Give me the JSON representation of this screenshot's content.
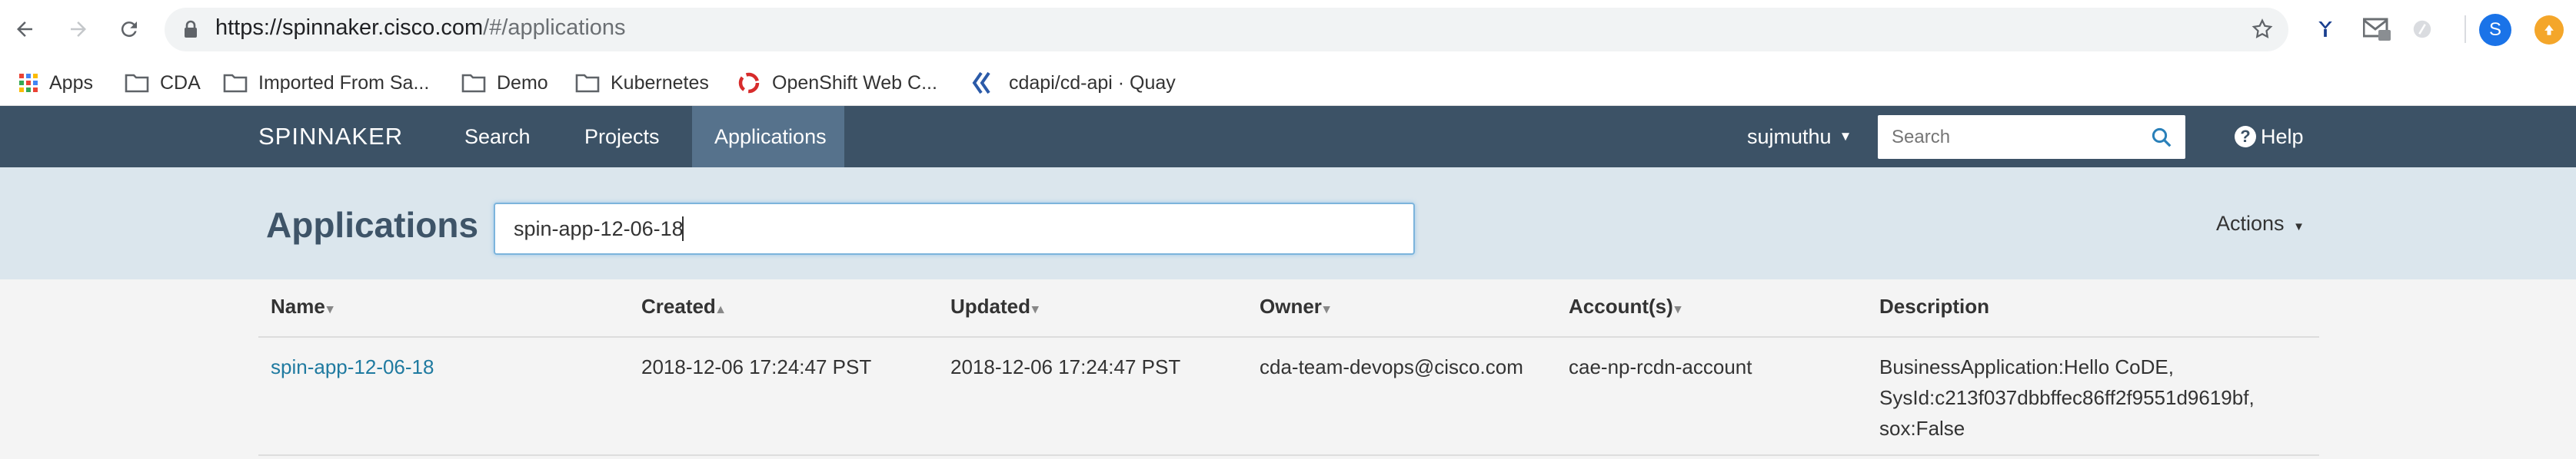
{
  "browser": {
    "url_host": "https://spinnaker.cisco.com",
    "url_path": "/#/applications",
    "profile_initial": "S"
  },
  "bookmarks": [
    {
      "label": "Apps"
    },
    {
      "label": "CDA"
    },
    {
      "label": "Imported From Sa..."
    },
    {
      "label": "Demo"
    },
    {
      "label": "Kubernetes"
    },
    {
      "label": "OpenShift Web C..."
    },
    {
      "label": "cdapi/cd-api · Quay"
    }
  ],
  "nav": {
    "brand": "SPINNAKER",
    "links": [
      "Search",
      "Projects",
      "Applications"
    ],
    "active": "Applications",
    "user": "sujmuthu",
    "search_placeholder": "Search",
    "help": "Help"
  },
  "header": {
    "title": "Applications",
    "filter_value": "spin-app-12-06-18",
    "actions": "Actions"
  },
  "table": {
    "columns": [
      {
        "label": "Name",
        "sort": "▾"
      },
      {
        "label": "Created",
        "sort": "▴"
      },
      {
        "label": "Updated",
        "sort": "▾"
      },
      {
        "label": "Owner",
        "sort": "▾"
      },
      {
        "label": "Account(s)",
        "sort": "▾"
      },
      {
        "label": "Description",
        "sort": ""
      }
    ],
    "rows": [
      {
        "name": "spin-app-12-06-18",
        "created": "2018-12-06 17:24:47 PST",
        "updated": "2018-12-06 17:24:47 PST",
        "owner": "cda-team-devops@cisco.com",
        "account": "cae-np-rcdn-account",
        "description_lines": [
          "BusinessApplication:Hello CoDE,",
          "SysId:c213f037dbbffec86ff2f9551d9619bf,",
          "sox:False"
        ]
      }
    ]
  },
  "colors": {
    "nav_bg": "#3c5266",
    "nav_active": "#56728c",
    "header_bg": "#dbe6ed",
    "link": "#1f7aa0",
    "accent_blue": "#1a73e8"
  }
}
